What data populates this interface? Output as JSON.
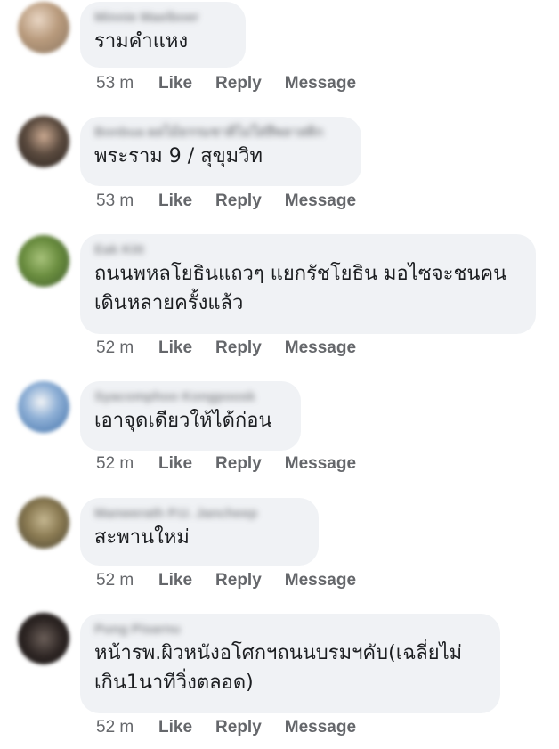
{
  "actions": {
    "like": "Like",
    "reply": "Reply",
    "message": "Message"
  },
  "comments": [
    {
      "author": "Minnie Maelboer",
      "text": "รามคำแหง",
      "time": "53 m"
    },
    {
      "author": "Bonbua ผลไม้ธรรมชาติไม่ใส่สีพลาสติก",
      "text": "พระราม 9 / สุขุมวิท",
      "time": "53 m"
    },
    {
      "author": "Eak Kitt",
      "text": "ถนนพหลโยธินแถวๆ แยกรัชโยธิน มอไซจะชนคน\nเดินหลายครั้งแล้ว",
      "time": "52 m"
    },
    {
      "author": "Syacomphoo Kongpoosk",
      "text": "เอาจุดเดียวให้ได้ก่อน",
      "time": "52 m"
    },
    {
      "author": "Manwerath P.U. Jancheep",
      "text": "สะพานใหม่",
      "time": "52 m"
    },
    {
      "author": "Pung Pisarnu",
      "text": "หน้ารพ.ผิวหนังอโศกฯถนนบรมฯคับ(เฉลี่ยไม่\nเกิน1นาทีวิ่งตลอด)",
      "time": "52 m"
    }
  ]
}
